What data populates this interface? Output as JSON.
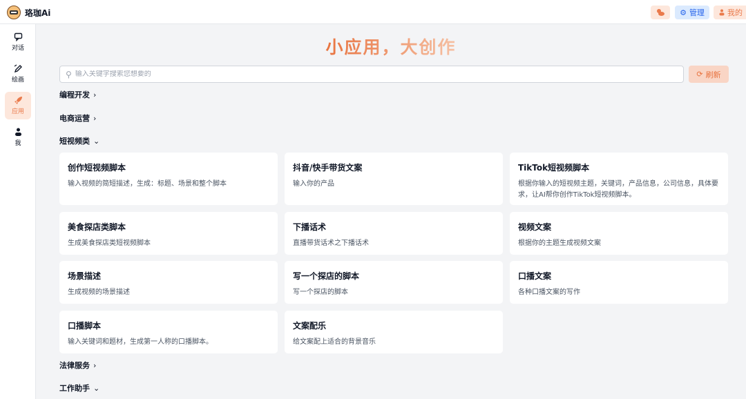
{
  "app": {
    "name": "珞珈Ai"
  },
  "header": {
    "admin_label": "管理",
    "mine_label": "我的"
  },
  "sidebar": {
    "items": [
      {
        "label": "对话",
        "icon": "chat-icon"
      },
      {
        "label": "绘画",
        "icon": "pen-icon"
      },
      {
        "label": "应用",
        "icon": "rocket-icon"
      },
      {
        "label": "我",
        "icon": "user-icon"
      }
    ]
  },
  "hero": {
    "title": "小应用，大创作"
  },
  "search": {
    "placeholder": "输入关键字搜索您想要的",
    "refresh_label": "刷新"
  },
  "categories": [
    {
      "name": "编程开发",
      "expanded": false
    },
    {
      "name": "电商运营",
      "expanded": false
    },
    {
      "name": "短视频类",
      "expanded": true
    },
    {
      "name": "法律服务",
      "expanded": false
    },
    {
      "name": "工作助手",
      "expanded": true
    }
  ],
  "cards": [
    {
      "title": "创作短视频脚本",
      "desc": "输入视频的简短描述，生成：标题、场景和整个脚本"
    },
    {
      "title": "抖音/快手带货文案",
      "desc": "输入你的产品"
    },
    {
      "title": "TikTok短视频脚本",
      "desc": "根据你输入的短视频主题，关键词，产品信息，公司信息，具体要求，让AI帮你创作TikTok短视频脚本。"
    },
    {
      "title": "美食探店类脚本",
      "desc": "生成美食探店类短视频脚本"
    },
    {
      "title": "下播话术",
      "desc": "直播带货话术之下播话术"
    },
    {
      "title": "视频文案",
      "desc": "根据你的主题生成视频文案"
    },
    {
      "title": "场景描述",
      "desc": "生成视频的场景描述"
    },
    {
      "title": "写一个探店的脚本",
      "desc": "写一个探店的脚本"
    },
    {
      "title": "口播文案",
      "desc": "各种口播文案的写作"
    },
    {
      "title": "口播脚本",
      "desc": "输入关键词和题材，生成第一人称的口播脚本。"
    },
    {
      "title": "文案配乐",
      "desc": "给文案配上适合的背景音乐"
    }
  ],
  "colors": {
    "accent": "#ea7a4b",
    "admin": "#2563eb",
    "background": "#f3f4f6"
  }
}
